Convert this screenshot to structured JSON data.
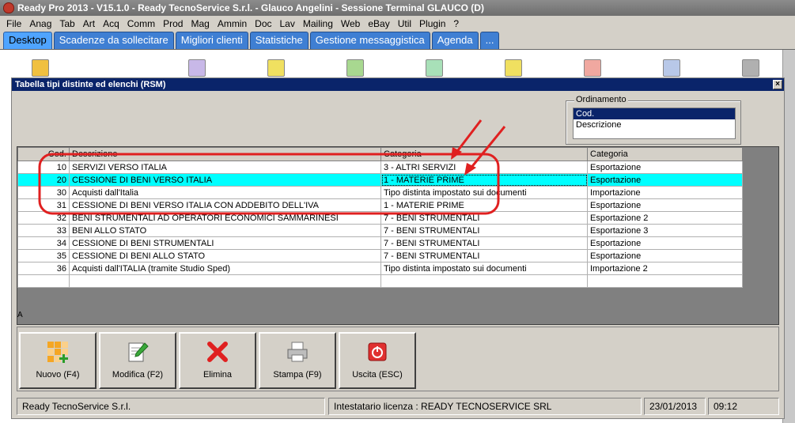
{
  "window": {
    "title": "Ready Pro 2013 - V15.1.0 - Ready TecnoService S.r.l. - Glauco Angelini - Sessione Terminal GLAUCO (D)"
  },
  "menu": [
    "File",
    "Anag",
    "Tab",
    "Art",
    "Acq",
    "Comm",
    "Prod",
    "Mag",
    "Ammin",
    "Doc",
    "Lav",
    "Mailing",
    "Web",
    "eBay",
    "Util",
    "Plugin",
    "?"
  ],
  "tabs": [
    "Desktop",
    "Scadenze da sollecitare",
    "Migliori clienti",
    "Statistiche",
    "Gestione messaggistica",
    "Agenda",
    "..."
  ],
  "dialog": {
    "title": "Tabella tipi distinte ed elenchi (RSM)",
    "close_label": "×",
    "ordinamento": {
      "legend": "Ordinamento",
      "options": [
        "Cod.",
        "Descrizione"
      ],
      "selected": "Cod."
    },
    "side_label": "A",
    "grid": {
      "headers": [
        "Cod.",
        "Descrizione",
        "Categoria",
        "Categoria"
      ],
      "rows": [
        {
          "cod": "10",
          "descrizione": "SERVIZI VERSO ITALIA",
          "categoria": "3 - ALTRI SERVIZI",
          "categoria2": "Esportazione"
        },
        {
          "cod": "20",
          "descrizione": "CESSIONE DI BENI VERSO ITALIA",
          "categoria": "1 - MATERIE PRIME",
          "categoria2": "Esportazione"
        },
        {
          "cod": "30",
          "descrizione": "Acquisti dall'Italia",
          "categoria": "Tipo distinta impostato sui documenti",
          "categoria2": "Importazione"
        },
        {
          "cod": "31",
          "descrizione": "CESSIONE DI BENI VERSO ITALIA CON ADDEBITO DELL'IVA",
          "categoria": "1 - MATERIE PRIME",
          "categoria2": "Esportazione"
        },
        {
          "cod": "32",
          "descrizione": "BENI STRUMENTALI AD OPERATORI ECONOMICI SAMMARINESI",
          "categoria": "7 - BENI STRUMENTALI",
          "categoria2": "Esportazione 2"
        },
        {
          "cod": "33",
          "descrizione": "BENI ALLO STATO",
          "categoria": "7 - BENI STRUMENTALI",
          "categoria2": "Esportazione 3"
        },
        {
          "cod": "34",
          "descrizione": "CESSIONE DI BENI STRUMENTALI",
          "categoria": "7 - BENI STRUMENTALI",
          "categoria2": "Esportazione"
        },
        {
          "cod": "35",
          "descrizione": "CESSIONE DI BENI ALLO STATO",
          "categoria": "7 - BENI STRUMENTALI",
          "categoria2": "Esportazione"
        },
        {
          "cod": "36",
          "descrizione": "Acquisti dall'ITALIA (tramite Studio Sped)",
          "categoria": "Tipo distinta impostato sui documenti",
          "categoria2": "Importazione 2"
        }
      ],
      "selected_cod": "20"
    },
    "buttons": {
      "nuovo": "Nuovo (F4)",
      "modifica": "Modifica (F2)",
      "elimina": "Elimina",
      "stampa": "Stampa (F9)",
      "uscita": "Uscita (ESC)"
    },
    "status": {
      "company": "Ready TecnoService S.r.l.",
      "license": "Intestatario licenza : READY TECNOSERVICE SRL",
      "date": "23/01/2013",
      "time": "09:12"
    }
  },
  "colors": {
    "selection": "#00ffff",
    "annotation": "#e02020",
    "title_bar": "#0a246a",
    "tab": "#3f7fd3"
  }
}
